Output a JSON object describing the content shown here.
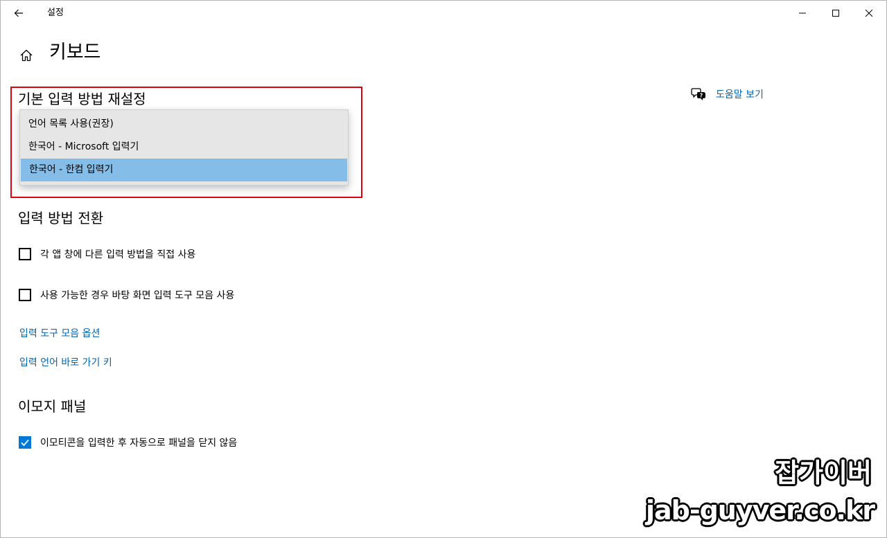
{
  "window": {
    "title": "설정"
  },
  "page": {
    "title": "키보드"
  },
  "help": {
    "label": "도움말 보기"
  },
  "default_input": {
    "heading": "기본 입력 방법 재설정",
    "options": [
      {
        "label": "언어 목록 사용(권장)"
      },
      {
        "label": "한국어 - Microsoft 입력기"
      },
      {
        "label": "한국어 - 한컴 입력기"
      }
    ],
    "selected": "한국어 - 한컴 입력기"
  },
  "switching": {
    "heading": "입력 방법 전환",
    "checkboxes": [
      {
        "label": "각 앱 창에 다른 입력 방법을 직접 사용",
        "checked": false
      },
      {
        "label": "사용 가능한 경우 바탕 화면 입력 도구 모음 사용",
        "checked": false
      }
    ],
    "links": [
      {
        "label": "입력 도구 모음 옵션"
      },
      {
        "label": "입력 언어 바로 가기 키"
      }
    ]
  },
  "emoji": {
    "heading": "이모지 패널",
    "checkboxes": [
      {
        "label": "이모티콘을 입력한 후 자동으로 패널을 닫지 않음",
        "checked": true
      }
    ]
  },
  "watermark": {
    "name": "잡가이버",
    "url": "jab-guyver.co.kr"
  },
  "colors": {
    "accent": "#0078d7",
    "link": "#0063b1",
    "selection": "#84bde8",
    "highlight_border": "#e0000f"
  },
  "icons": {
    "back": "arrow-left-icon",
    "minimize": "minimize-icon",
    "maximize": "maximize-icon",
    "close": "close-icon",
    "home": "home-icon",
    "help": "chat-help-icon",
    "check": "checkmark-icon"
  }
}
